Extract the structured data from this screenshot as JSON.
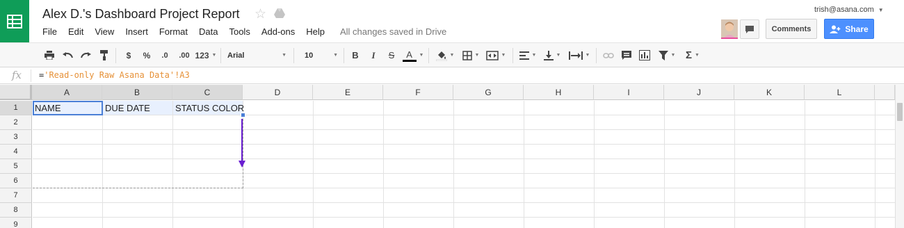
{
  "doc": {
    "title": "Alex D.'s Dashboard Project Report",
    "saved_status": "All changes saved in Drive",
    "account": "trish@asana.com"
  },
  "menu": [
    "File",
    "Edit",
    "View",
    "Insert",
    "Format",
    "Data",
    "Tools",
    "Add-ons",
    "Help"
  ],
  "buttons": {
    "comments": "Comments",
    "share": "Share"
  },
  "toolbar": {
    "currency": "$",
    "percent": "%",
    "decrease_decimal": ".0",
    "increase_decimal": ".00",
    "number_format": "123",
    "font": "Arial",
    "font_size": "10",
    "bold": "B",
    "italic": "I",
    "strikethrough": "S",
    "text_color": "A",
    "functions": "Σ"
  },
  "formula_bar": {
    "fx": "fx",
    "eq": "=",
    "ref": "'Read-only Raw Asana Data'!A3"
  },
  "grid": {
    "columns": [
      "A",
      "B",
      "C",
      "D",
      "E",
      "F",
      "G",
      "H",
      "I",
      "J",
      "K",
      "L"
    ],
    "rows": [
      "1",
      "2",
      "3",
      "4",
      "5",
      "6",
      "7",
      "8",
      "9"
    ],
    "row1": [
      "NAME",
      "DUE DATE",
      "STATUS COLOR"
    ]
  },
  "colors": {
    "sheets_green": "#0f9d58",
    "share_blue": "#4d90fe",
    "selection_blue": "#4a7fd6",
    "formula_ref": "#e69138",
    "drag_arrow": "#6a1fd1"
  }
}
